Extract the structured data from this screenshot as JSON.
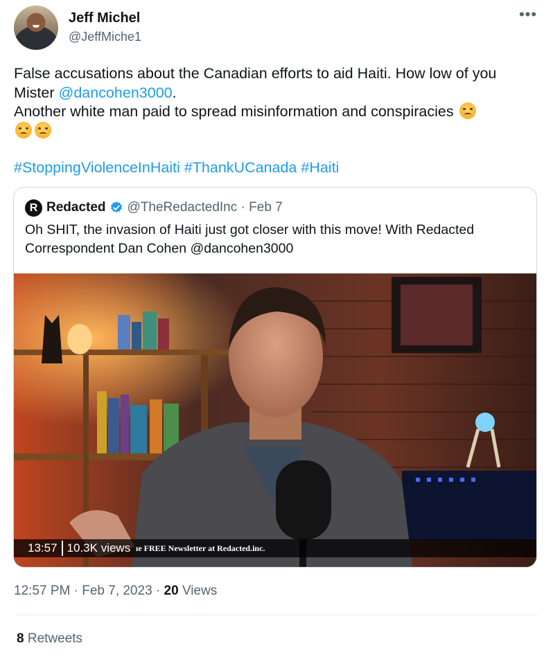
{
  "tweet": {
    "author_name": "Jeff Michel",
    "author_handle": "@JeffMiche1",
    "more_icon": "•••",
    "text_part1": "False accusations about the Canadian efforts to aid Haiti. How low of you Mister ",
    "mention": "@dancohen3000",
    "text_part2": ".",
    "text_line2": "Another white man paid to spread misinformation and conspiracies",
    "emoji": "angry-face-emoji",
    "hashtags": "#StoppingViolenceInHaiti #ThankUCanada #Haiti",
    "time": "12:57 PM",
    "date": "Feb 7, 2023",
    "views_count": "20",
    "views_label": "Views",
    "retweets_count": "8",
    "retweets_label": "Retweets"
  },
  "quoted": {
    "logo_letter": "R",
    "name": "Redacted",
    "handle": "@TheRedactedInc",
    "date": "Feb 7",
    "text": "Oh SHIT, the invasion of Haiti just got closer with this move! With Redacted Correspondent Dan Cohen @dancohen3000",
    "video": {
      "duration": "13:57",
      "views": "10.3K views",
      "overlay_text": "ıe FREE Newsletter at Redacted.inc."
    }
  },
  "colors": {
    "link": "#1d9bf0",
    "secondary_text": "#536471",
    "border": "#cfd9de"
  }
}
